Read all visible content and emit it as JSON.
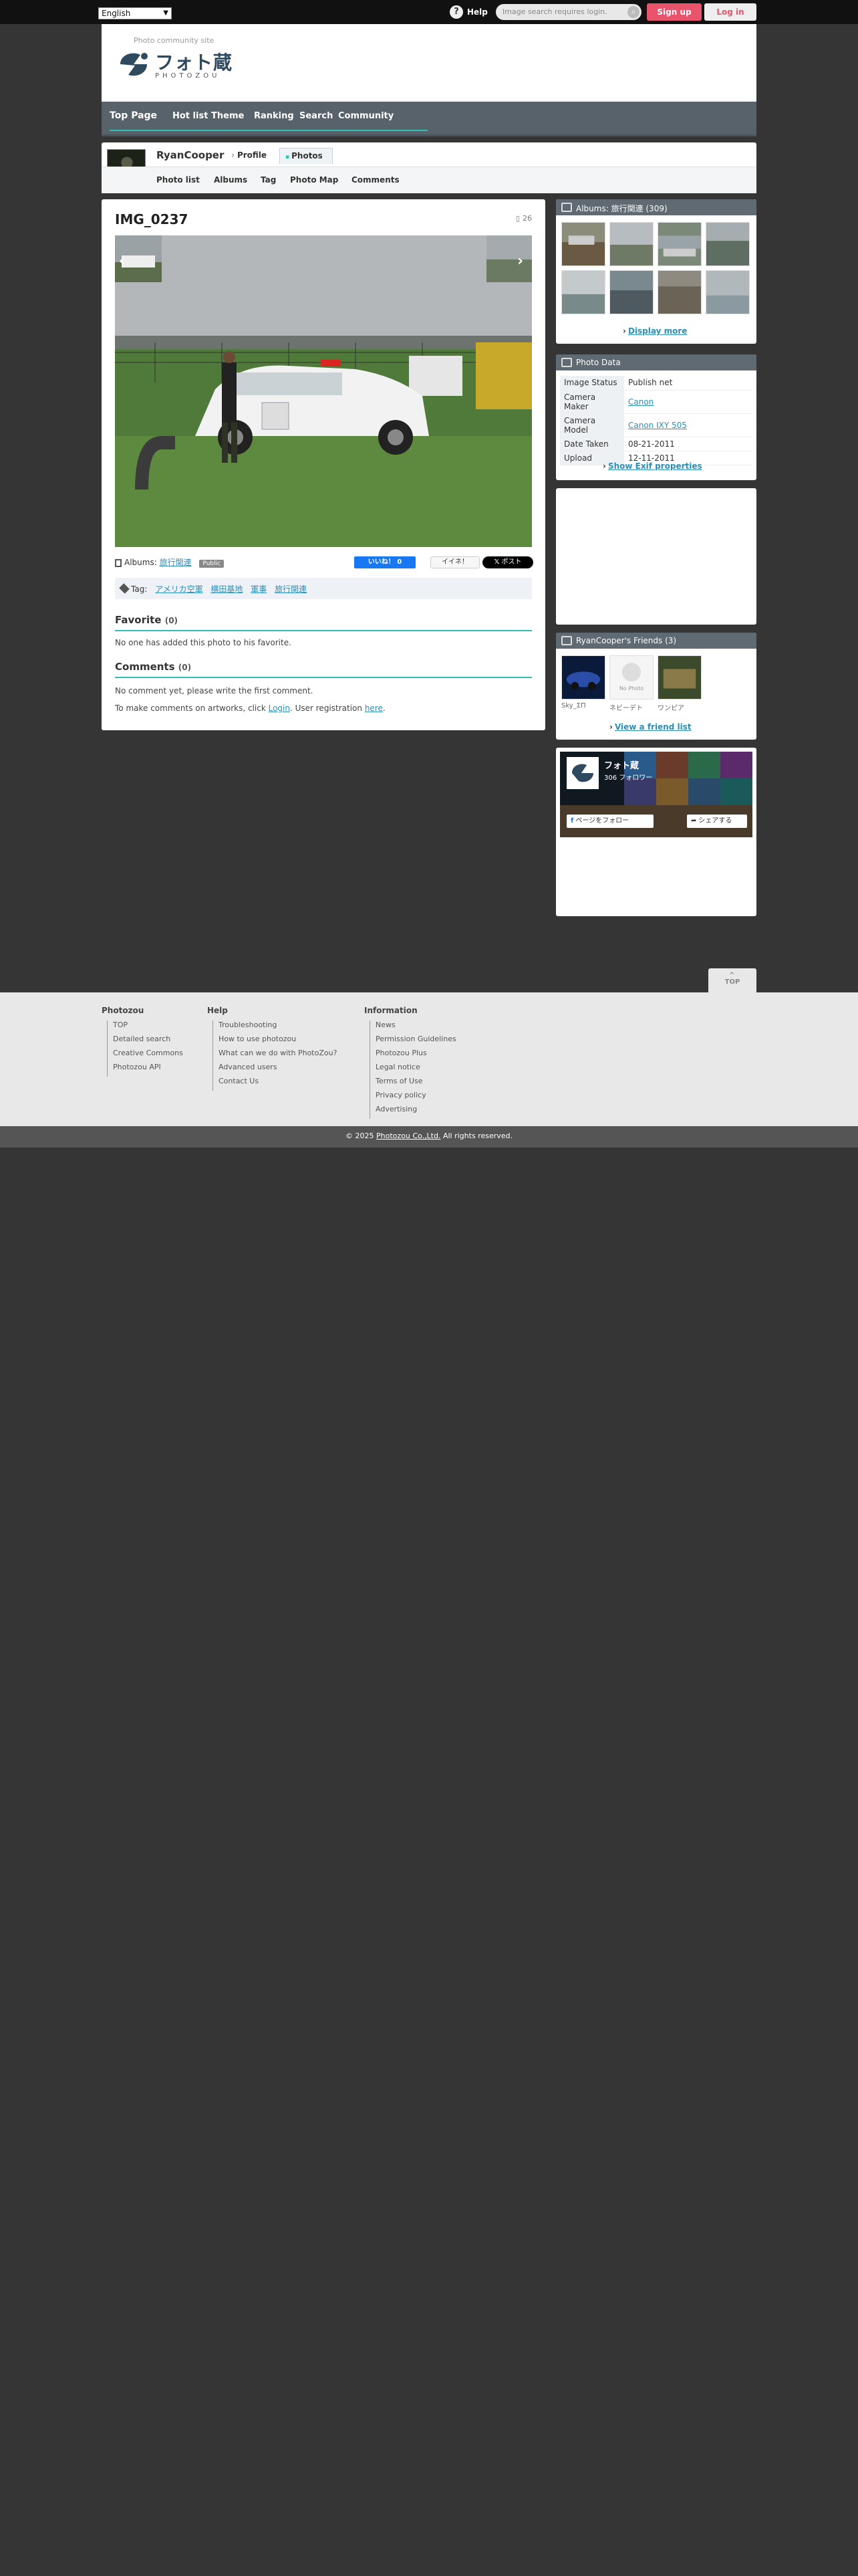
{
  "topbar": {
    "language": "English",
    "help_label": "Help",
    "search_placeholder": "Image search requires login.",
    "signup_label": "Sign up",
    "login_label": "Log in"
  },
  "header": {
    "tagline": "Photo community site",
    "logo_jp": "フォト蔵",
    "logo_en": "PHOTOZOU"
  },
  "nav": {
    "items": [
      "Top Page",
      "Hot list",
      "Theme",
      "Ranking",
      "Search",
      "Community"
    ]
  },
  "profile": {
    "name": "RyanCooper",
    "tab_profile": "Profile",
    "tab_photos": "Photos",
    "sub_items": [
      "Photo list",
      "Albums",
      "Tag",
      "Photo Map",
      "Comments"
    ]
  },
  "photo": {
    "title": "IMG_0237",
    "views": "26",
    "albums_label": "Albums:",
    "album_name": "旅行関連",
    "public_label": "Public",
    "fb_like": "いいね！ 0",
    "iine": "イイネ！",
    "x_post": "ポスト",
    "tag_label": "Tag:",
    "tags": [
      "アメリカ空軍",
      "横田基地",
      "軍事",
      "旅行関連"
    ]
  },
  "favorite": {
    "heading": "Favorite",
    "count": "(0)",
    "text": "No one has added this photo to his favorite."
  },
  "comments": {
    "heading": "Comments",
    "count": "(0)",
    "empty_text": "No comment yet, please write the first comment.",
    "login_prefix": "To make comments on artworks, click ",
    "login_link": "Login",
    "login_mid": ". User registration ",
    "here_link": "here",
    "login_suffix": "."
  },
  "sidebar": {
    "albums_header": "Albums: 旅行関連 (309)",
    "display_more": "Display more",
    "photo_data_header": "Photo Data",
    "photo_data": [
      {
        "key": "Image Status",
        "value": "Publish net",
        "link": false
      },
      {
        "key": "Camera Maker",
        "value": "Canon",
        "link": true
      },
      {
        "key": "Camera Model",
        "value": "Canon IXY 505",
        "link": true
      },
      {
        "key": "Date Taken",
        "value": "08-21-2011",
        "link": false
      },
      {
        "key": "Upload",
        "value": "12-11-2011",
        "link": false
      }
    ],
    "show_exif": "Show Exif properties",
    "friends_header": "RyanCooper's Friends (3)",
    "friends": [
      "Sky_ΣΠ",
      "ネビーデト",
      "ワンピア"
    ],
    "no_photo": "No Photo",
    "view_friend_list": "View a friend list",
    "fb_page_name": "フォト蔵",
    "fb_followers": "306 フォロワー",
    "fb_follow": "ページをフォロー",
    "fb_share": "シェアする"
  },
  "footer": {
    "top_label": "TOP",
    "col1": {
      "title": "Photozou",
      "links": [
        "TOP",
        "Detailed search",
        "Creative Commons",
        "Photozou API"
      ]
    },
    "col2": {
      "title": "Help",
      "links": [
        "Troubleshooting",
        "How to use photozou",
        "What can we do with PhotoZou?",
        "Advanced users",
        "Contact Us"
      ]
    },
    "col3": {
      "title": "Information",
      "links": [
        "News",
        "Permission Guidelines",
        "Photozou Plus",
        "Legal notice",
        "Terms of Use",
        "Privacy policy",
        "Advertising"
      ]
    },
    "copyright_prefix": "© 2025 ",
    "copyright_link": "Photozou Co.,Ltd.",
    "copyright_suffix": " All rights reserved."
  }
}
